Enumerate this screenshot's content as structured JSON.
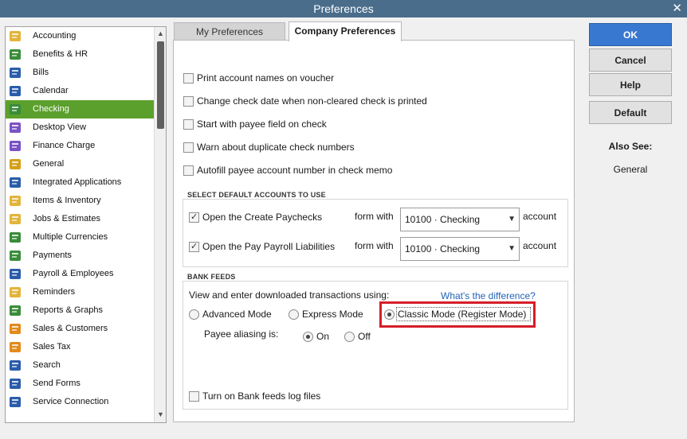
{
  "window": {
    "title": "Preferences",
    "close_glyph": "✕"
  },
  "sidebar": {
    "items": [
      {
        "label": "Accounting",
        "icon": "accounting-icon",
        "color": "#e3b43a"
      },
      {
        "label": "Benefits & HR",
        "icon": "benefits-hr-icon",
        "color": "#3a8c3a"
      },
      {
        "label": "Bills",
        "icon": "bills-icon",
        "color": "#2a5caa"
      },
      {
        "label": "Calendar",
        "icon": "calendar-icon",
        "color": "#2a5caa"
      },
      {
        "label": "Checking",
        "icon": "checking-icon",
        "color": "#3a8c3a",
        "selected": true
      },
      {
        "label": "Desktop View",
        "icon": "desktop-view-icon",
        "color": "#7a52c4"
      },
      {
        "label": "Finance Charge",
        "icon": "finance-charge-icon",
        "color": "#7a52c4"
      },
      {
        "label": "General",
        "icon": "general-icon",
        "color": "#d4a017"
      },
      {
        "label": "Integrated Applications",
        "icon": "integrated-applications-icon",
        "color": "#2a5caa"
      },
      {
        "label": "Items & Inventory",
        "icon": "items-inventory-icon",
        "color": "#e3b43a"
      },
      {
        "label": "Jobs & Estimates",
        "icon": "jobs-estimates-icon",
        "color": "#e3b43a"
      },
      {
        "label": "Multiple Currencies",
        "icon": "multiple-currencies-icon",
        "color": "#3a8c3a"
      },
      {
        "label": "Payments",
        "icon": "payments-icon",
        "color": "#3a8c3a"
      },
      {
        "label": "Payroll & Employees",
        "icon": "payroll-employees-icon",
        "color": "#2a5caa"
      },
      {
        "label": "Reminders",
        "icon": "reminders-icon",
        "color": "#e3b43a"
      },
      {
        "label": "Reports & Graphs",
        "icon": "reports-graphs-icon",
        "color": "#3a8c3a"
      },
      {
        "label": "Sales & Customers",
        "icon": "sales-customers-icon",
        "color": "#e38a1a"
      },
      {
        "label": "Sales Tax",
        "icon": "sales-tax-icon",
        "color": "#e38a1a"
      },
      {
        "label": "Search",
        "icon": "search-icon",
        "color": "#2a5caa"
      },
      {
        "label": "Send Forms",
        "icon": "send-forms-icon",
        "color": "#2a5caa"
      },
      {
        "label": "Service Connection",
        "icon": "service-connection-icon",
        "color": "#2a5caa"
      }
    ],
    "scroll_up": "▲",
    "scroll_down": "▼"
  },
  "tabs": {
    "my": "My Preferences",
    "company": "Company Preferences"
  },
  "options": [
    {
      "label": "Print account names on voucher",
      "checked": false
    },
    {
      "label": "Change check date when non-cleared check is printed",
      "checked": false
    },
    {
      "label": "Start with payee field on check",
      "checked": false
    },
    {
      "label": "Warn about duplicate check numbers",
      "checked": false
    },
    {
      "label": "Autofill payee account number in check memo",
      "checked": false
    }
  ],
  "default_accounts": {
    "title": "SELECT DEFAULT ACCOUNTS TO USE",
    "rows": [
      {
        "label": "Open the Create Paychecks",
        "checked": true,
        "form_with": "form with",
        "account": "10100 · Checking",
        "suffix": "account"
      },
      {
        "label": "Open the Pay Payroll Liabilities",
        "checked": true,
        "form_with": "form with",
        "account": "10100 · Checking",
        "suffix": "account"
      }
    ]
  },
  "bank_feeds": {
    "title": "BANK FEEDS",
    "prompt": "View and enter downloaded transactions using:",
    "link": "What's the difference?",
    "modes": [
      {
        "label": "Advanced Mode",
        "checked": false
      },
      {
        "label": "Express Mode",
        "checked": false
      },
      {
        "label": "Classic Mode (Register Mode)",
        "checked": true
      }
    ],
    "aliasing_label": "Payee aliasing is:",
    "aliasing": [
      {
        "label": "On",
        "checked": true
      },
      {
        "label": "Off",
        "checked": false
      }
    ],
    "log_label": "Turn on Bank feeds log files",
    "log_checked": false
  },
  "buttons": {
    "ok": "OK",
    "cancel": "Cancel",
    "help": "Help",
    "default": "Default"
  },
  "also_see": {
    "title": "Also See:",
    "general": "General"
  },
  "colors": {
    "accent": "#3978d0",
    "selected": "#5ba02c",
    "highlight": "#d51e28",
    "titlebar": "#4a6d8c"
  }
}
